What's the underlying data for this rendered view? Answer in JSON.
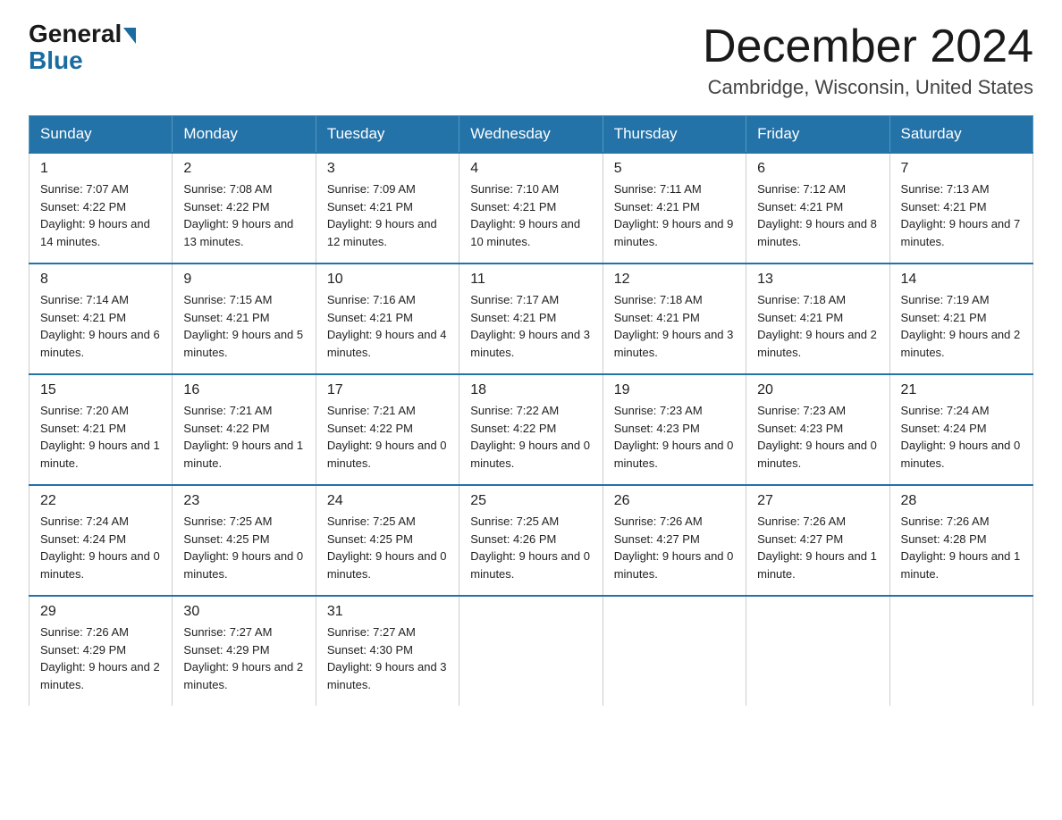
{
  "header": {
    "logo_general": "General",
    "logo_blue": "Blue",
    "month_title": "December 2024",
    "location": "Cambridge, Wisconsin, United States"
  },
  "days_of_week": [
    "Sunday",
    "Monday",
    "Tuesday",
    "Wednesday",
    "Thursday",
    "Friday",
    "Saturday"
  ],
  "weeks": [
    [
      {
        "day": "1",
        "sunrise": "7:07 AM",
        "sunset": "4:22 PM",
        "daylight": "9 hours and 14 minutes."
      },
      {
        "day": "2",
        "sunrise": "7:08 AM",
        "sunset": "4:22 PM",
        "daylight": "9 hours and 13 minutes."
      },
      {
        "day": "3",
        "sunrise": "7:09 AM",
        "sunset": "4:21 PM",
        "daylight": "9 hours and 12 minutes."
      },
      {
        "day": "4",
        "sunrise": "7:10 AM",
        "sunset": "4:21 PM",
        "daylight": "9 hours and 10 minutes."
      },
      {
        "day": "5",
        "sunrise": "7:11 AM",
        "sunset": "4:21 PM",
        "daylight": "9 hours and 9 minutes."
      },
      {
        "day": "6",
        "sunrise": "7:12 AM",
        "sunset": "4:21 PM",
        "daylight": "9 hours and 8 minutes."
      },
      {
        "day": "7",
        "sunrise": "7:13 AM",
        "sunset": "4:21 PM",
        "daylight": "9 hours and 7 minutes."
      }
    ],
    [
      {
        "day": "8",
        "sunrise": "7:14 AM",
        "sunset": "4:21 PM",
        "daylight": "9 hours and 6 minutes."
      },
      {
        "day": "9",
        "sunrise": "7:15 AM",
        "sunset": "4:21 PM",
        "daylight": "9 hours and 5 minutes."
      },
      {
        "day": "10",
        "sunrise": "7:16 AM",
        "sunset": "4:21 PM",
        "daylight": "9 hours and 4 minutes."
      },
      {
        "day": "11",
        "sunrise": "7:17 AM",
        "sunset": "4:21 PM",
        "daylight": "9 hours and 3 minutes."
      },
      {
        "day": "12",
        "sunrise": "7:18 AM",
        "sunset": "4:21 PM",
        "daylight": "9 hours and 3 minutes."
      },
      {
        "day": "13",
        "sunrise": "7:18 AM",
        "sunset": "4:21 PM",
        "daylight": "9 hours and 2 minutes."
      },
      {
        "day": "14",
        "sunrise": "7:19 AM",
        "sunset": "4:21 PM",
        "daylight": "9 hours and 2 minutes."
      }
    ],
    [
      {
        "day": "15",
        "sunrise": "7:20 AM",
        "sunset": "4:21 PM",
        "daylight": "9 hours and 1 minute."
      },
      {
        "day": "16",
        "sunrise": "7:21 AM",
        "sunset": "4:22 PM",
        "daylight": "9 hours and 1 minute."
      },
      {
        "day": "17",
        "sunrise": "7:21 AM",
        "sunset": "4:22 PM",
        "daylight": "9 hours and 0 minutes."
      },
      {
        "day": "18",
        "sunrise": "7:22 AM",
        "sunset": "4:22 PM",
        "daylight": "9 hours and 0 minutes."
      },
      {
        "day": "19",
        "sunrise": "7:23 AM",
        "sunset": "4:23 PM",
        "daylight": "9 hours and 0 minutes."
      },
      {
        "day": "20",
        "sunrise": "7:23 AM",
        "sunset": "4:23 PM",
        "daylight": "9 hours and 0 minutes."
      },
      {
        "day": "21",
        "sunrise": "7:24 AM",
        "sunset": "4:24 PM",
        "daylight": "9 hours and 0 minutes."
      }
    ],
    [
      {
        "day": "22",
        "sunrise": "7:24 AM",
        "sunset": "4:24 PM",
        "daylight": "9 hours and 0 minutes."
      },
      {
        "day": "23",
        "sunrise": "7:25 AM",
        "sunset": "4:25 PM",
        "daylight": "9 hours and 0 minutes."
      },
      {
        "day": "24",
        "sunrise": "7:25 AM",
        "sunset": "4:25 PM",
        "daylight": "9 hours and 0 minutes."
      },
      {
        "day": "25",
        "sunrise": "7:25 AM",
        "sunset": "4:26 PM",
        "daylight": "9 hours and 0 minutes."
      },
      {
        "day": "26",
        "sunrise": "7:26 AM",
        "sunset": "4:27 PM",
        "daylight": "9 hours and 0 minutes."
      },
      {
        "day": "27",
        "sunrise": "7:26 AM",
        "sunset": "4:27 PM",
        "daylight": "9 hours and 1 minute."
      },
      {
        "day": "28",
        "sunrise": "7:26 AM",
        "sunset": "4:28 PM",
        "daylight": "9 hours and 1 minute."
      }
    ],
    [
      {
        "day": "29",
        "sunrise": "7:26 AM",
        "sunset": "4:29 PM",
        "daylight": "9 hours and 2 minutes."
      },
      {
        "day": "30",
        "sunrise": "7:27 AM",
        "sunset": "4:29 PM",
        "daylight": "9 hours and 2 minutes."
      },
      {
        "day": "31",
        "sunrise": "7:27 AM",
        "sunset": "4:30 PM",
        "daylight": "9 hours and 3 minutes."
      },
      null,
      null,
      null,
      null
    ]
  ]
}
